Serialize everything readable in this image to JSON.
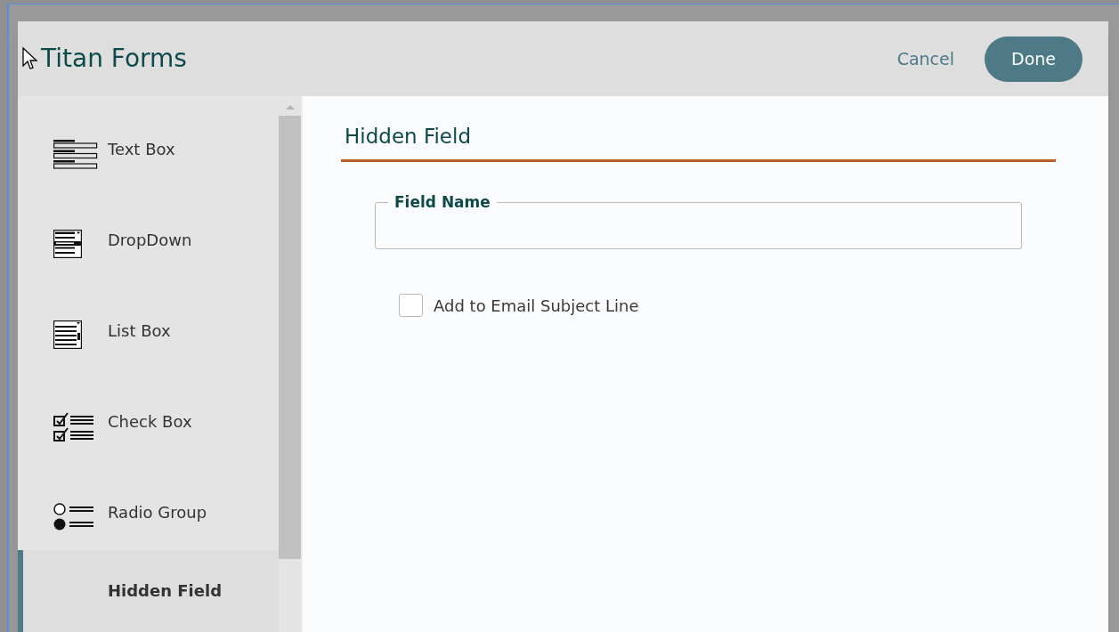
{
  "header": {
    "title": "Titan Forms",
    "cancel": "Cancel",
    "done": "Done"
  },
  "sidebar": {
    "items": [
      {
        "label": "Text Box",
        "kind": "textbox",
        "selected": false
      },
      {
        "label": "DropDown",
        "kind": "dropdown",
        "selected": false
      },
      {
        "label": "List Box",
        "kind": "listbox",
        "selected": false
      },
      {
        "label": "Check Box",
        "kind": "checkbox",
        "selected": false
      },
      {
        "label": "Radio Group",
        "kind": "radio",
        "selected": false
      },
      {
        "label": "Hidden Field",
        "kind": "hidden",
        "selected": true
      }
    ]
  },
  "panel": {
    "heading": "Hidden Field",
    "field": {
      "label": "Field Name"
    },
    "option": {
      "label": "Add to Email Subject Line",
      "checked": false
    }
  }
}
